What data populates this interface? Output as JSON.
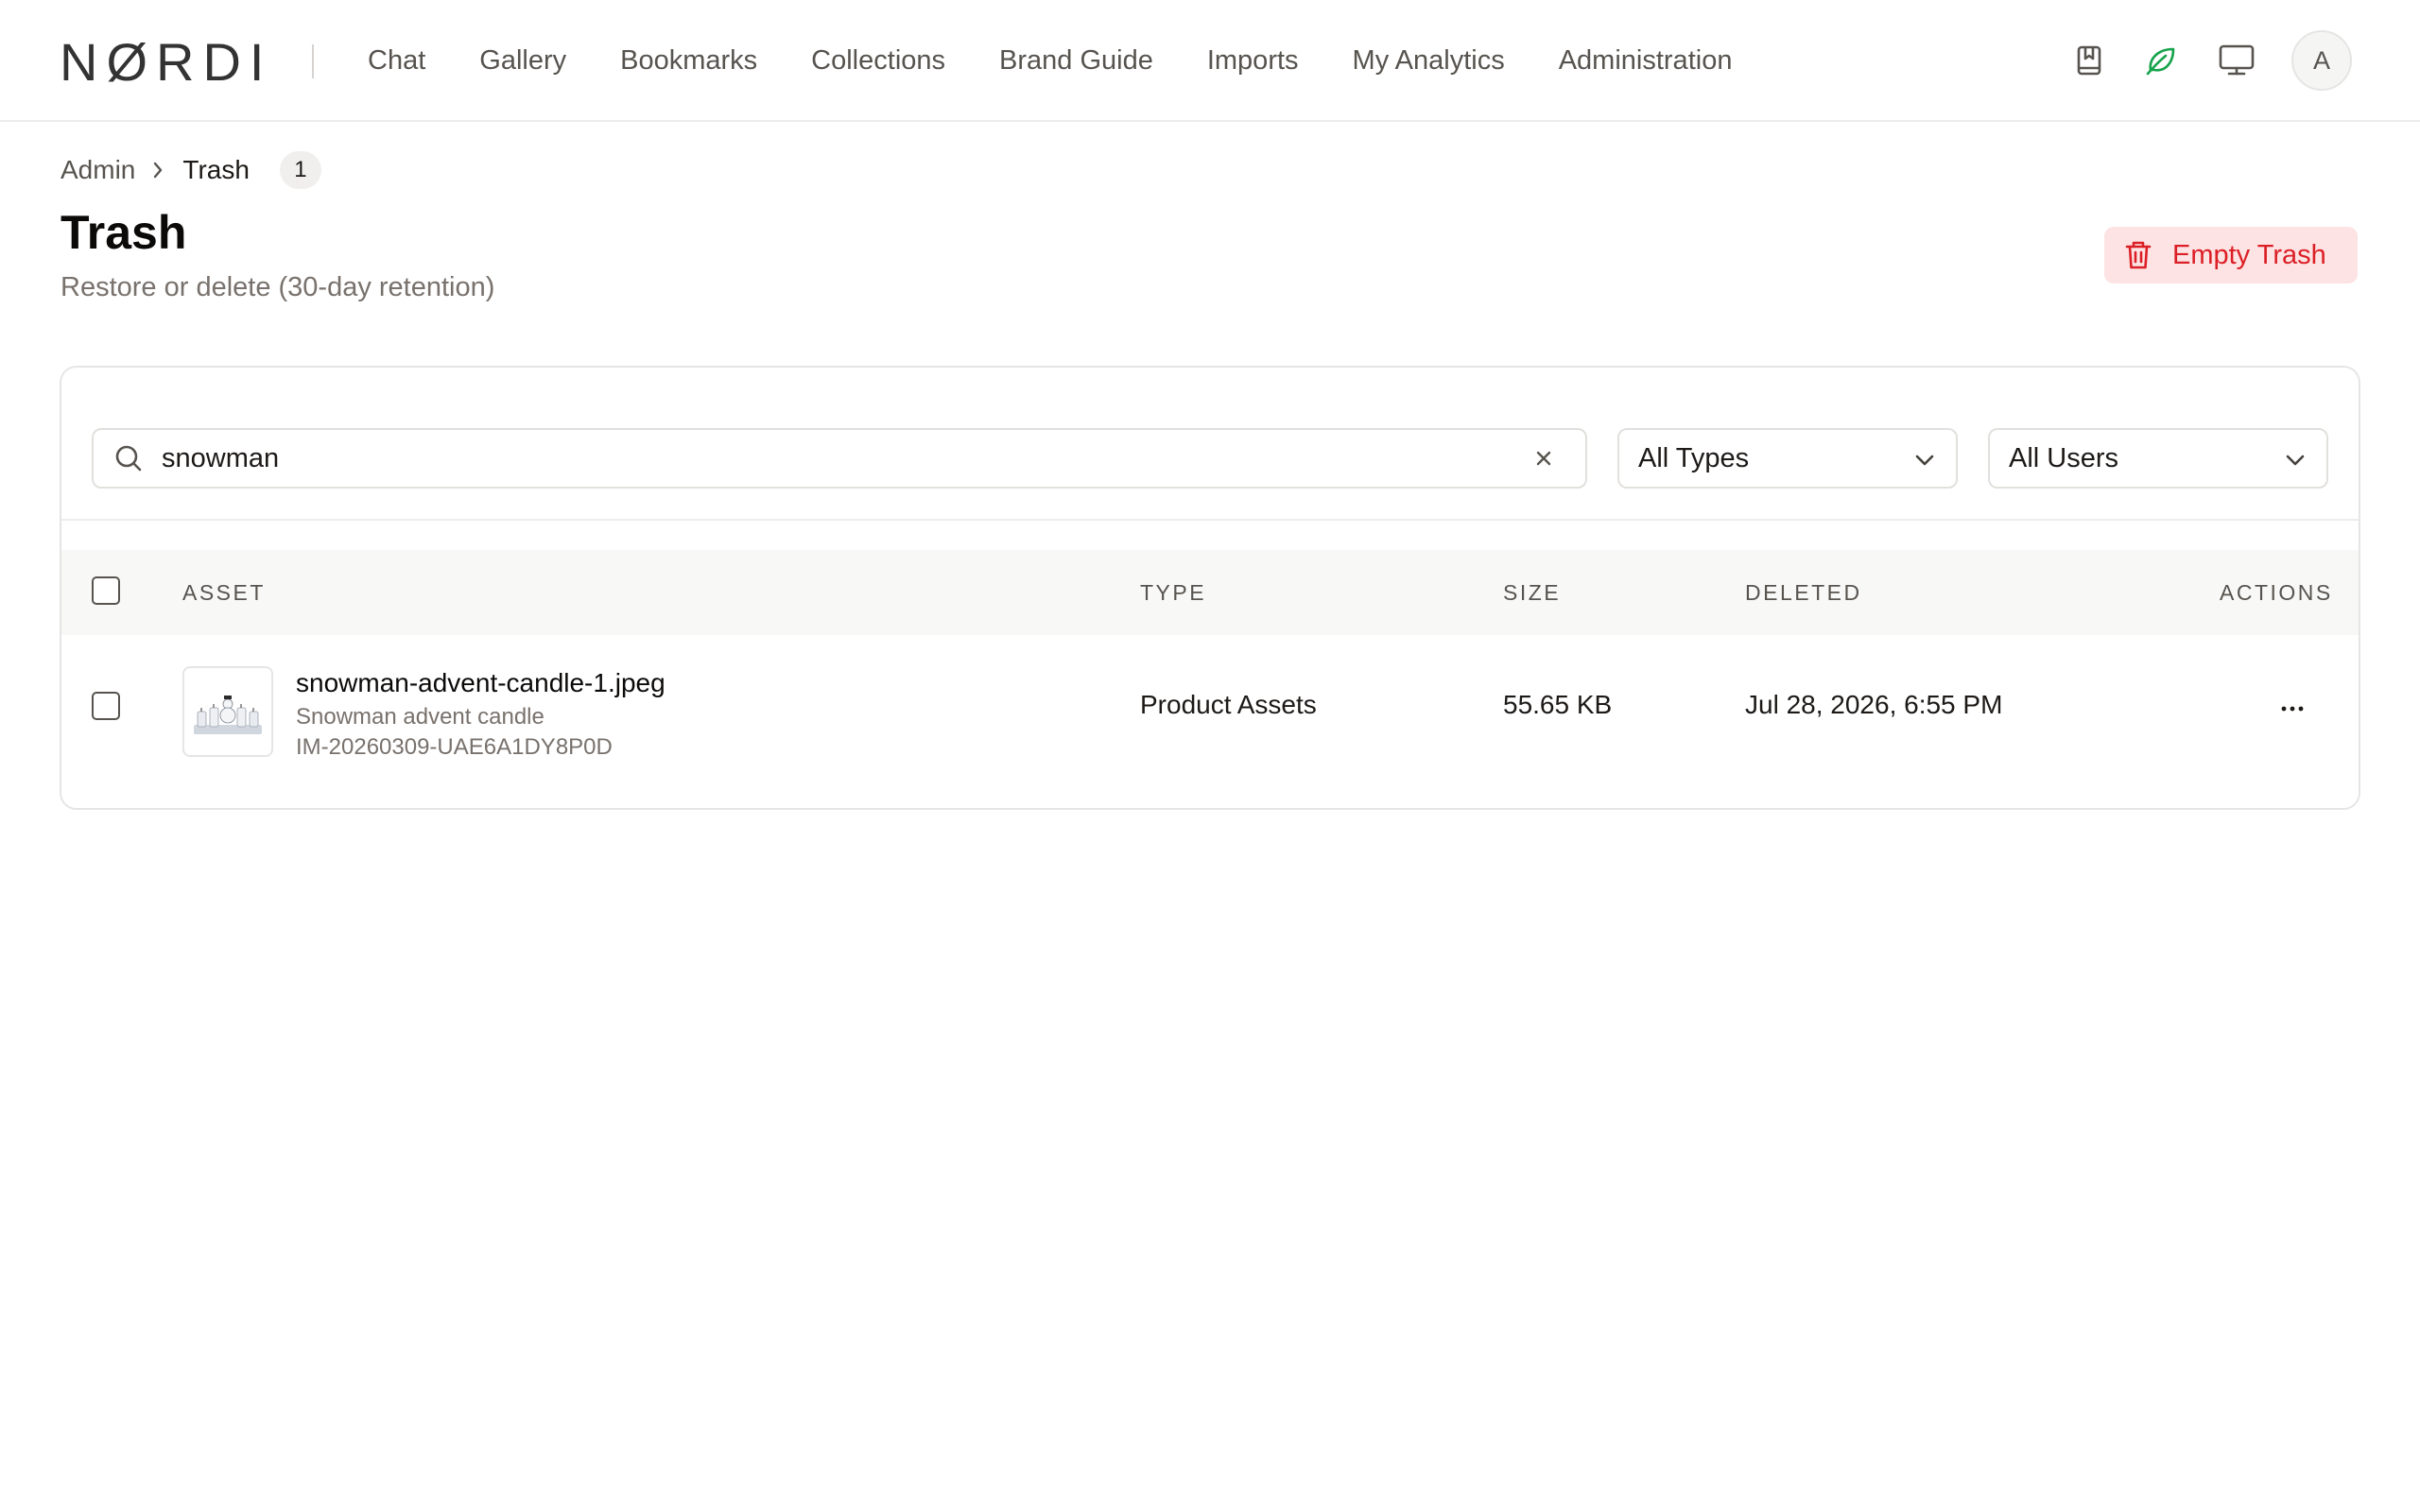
{
  "header": {
    "logo": "NØRDI",
    "nav": [
      "Chat",
      "Gallery",
      "Bookmarks",
      "Collections",
      "Brand Guide",
      "Imports",
      "My Analytics",
      "Administration"
    ],
    "avatar_initial": "A"
  },
  "breadcrumb": {
    "parent": "Admin",
    "current": "Trash",
    "count": "1"
  },
  "page": {
    "title": "Trash",
    "subtitle": "Restore or delete (30-day retention)",
    "empty_button": "Empty Trash"
  },
  "filters": {
    "search_value": "snowman",
    "type_select": "All Types",
    "user_select": "All Users"
  },
  "table": {
    "columns": [
      "ASSET",
      "TYPE",
      "SIZE",
      "DELETED",
      "ACTIONS"
    ],
    "rows": [
      {
        "name": "snowman-advent-candle-1.jpeg",
        "description": "Snowman advent candle",
        "id": "IM-20260309-UAE6A1DY8P0D",
        "type": "Product Assets",
        "size": "55.65 KB",
        "deleted": "Jul 28, 2026, 6:55 PM"
      }
    ]
  },
  "colors": {
    "danger": "#dc1f26",
    "danger_bg": "#fde3e3",
    "accent_green": "#16a34a",
    "muted_text": "#57534e"
  }
}
